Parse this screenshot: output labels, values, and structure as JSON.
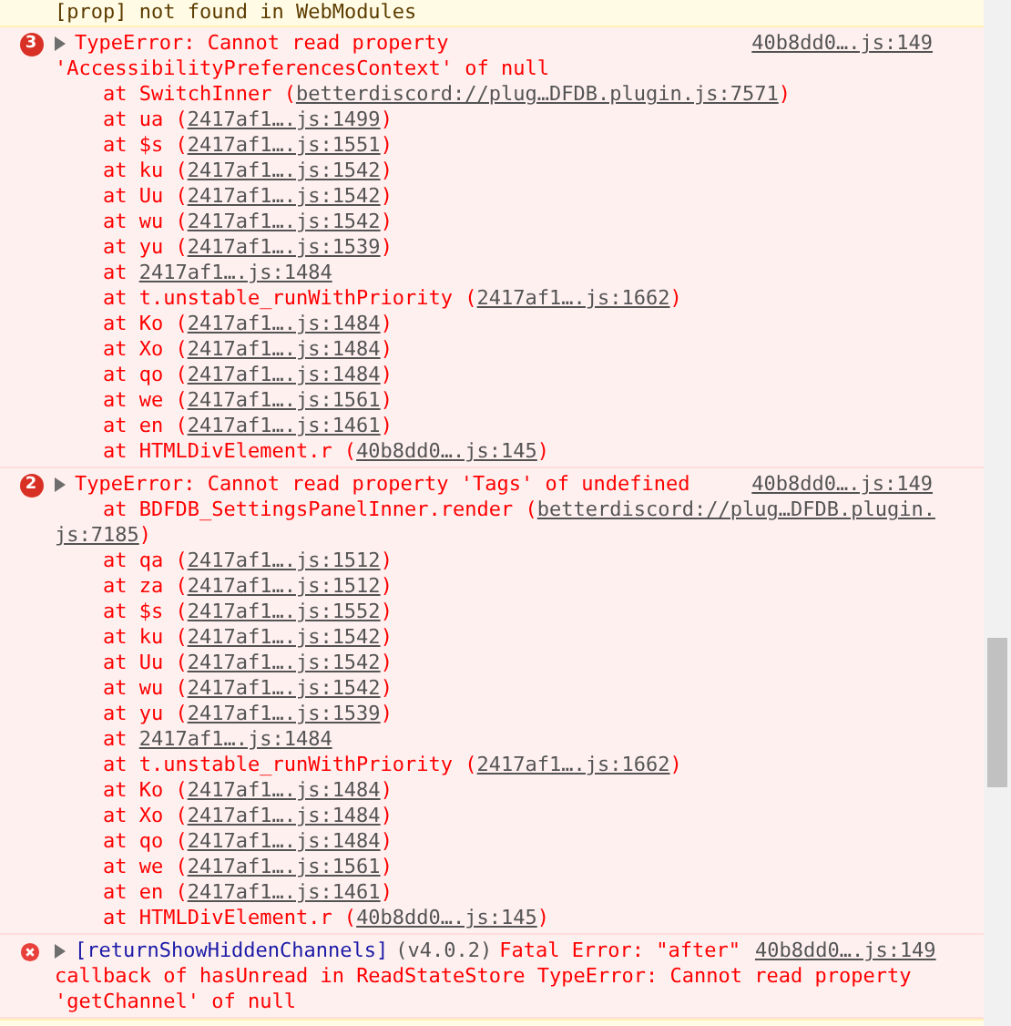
{
  "warning_above": {
    "text": "[prop] not found in WebModules"
  },
  "entries": [
    {
      "kind": "grouped",
      "count": "3",
      "message_lines": [
        "TypeError: Cannot read property",
        "'AccessibilityPreferencesContext' of null"
      ],
      "source": "40b8dd0….js:149",
      "frames": [
        {
          "prefix": "at SwitchInner (",
          "location": "betterdiscord://plug…DFDB.plugin.js:7571",
          "suffix": ")"
        },
        {
          "prefix": "at ua (",
          "location": "2417af1….js:1499",
          "suffix": ")"
        },
        {
          "prefix": "at $s (",
          "location": "2417af1….js:1551",
          "suffix": ")"
        },
        {
          "prefix": "at ku (",
          "location": "2417af1….js:1542",
          "suffix": ")"
        },
        {
          "prefix": "at Uu (",
          "location": "2417af1….js:1542",
          "suffix": ")"
        },
        {
          "prefix": "at wu (",
          "location": "2417af1….js:1542",
          "suffix": ")"
        },
        {
          "prefix": "at yu (",
          "location": "2417af1….js:1539",
          "suffix": ")"
        },
        {
          "prefix": "at",
          "location": "2417af1….js:1484"
        },
        {
          "prefix": "at t.unstable_runWithPriority (",
          "location": "2417af1….js:1662",
          "suffix": ")"
        },
        {
          "prefix": "at Ko (",
          "location": "2417af1….js:1484",
          "suffix": ")"
        },
        {
          "prefix": "at Xo (",
          "location": "2417af1….js:1484",
          "suffix": ")"
        },
        {
          "prefix": "at qo (",
          "location": "2417af1….js:1484",
          "suffix": ")"
        },
        {
          "prefix": "at we (",
          "location": "2417af1….js:1561",
          "suffix": ")"
        },
        {
          "prefix": "at en (",
          "location": "2417af1….js:1461",
          "suffix": ")"
        },
        {
          "prefix": "at HTMLDivElement.r (",
          "location": "40b8dd0….js:145",
          "suffix": ")"
        }
      ]
    },
    {
      "kind": "grouped",
      "count": "2",
      "message_lines": [
        "TypeError: Cannot read property 'Tags' of undefined"
      ],
      "source": "40b8dd0….js:149",
      "frames": [
        {
          "prefix": "at BDFDB_SettingsPanelInner.render (",
          "location": "betterdiscord://plug…DFDB.plugin.",
          "location_continued": "js:7185",
          "suffix": ")"
        },
        {
          "prefix": "at qa (",
          "location": "2417af1….js:1512",
          "suffix": ")"
        },
        {
          "prefix": "at za (",
          "location": "2417af1….js:1512",
          "suffix": ")"
        },
        {
          "prefix": "at $s (",
          "location": "2417af1….js:1552",
          "suffix": ")"
        },
        {
          "prefix": "at ku (",
          "location": "2417af1….js:1542",
          "suffix": ")"
        },
        {
          "prefix": "at Uu (",
          "location": "2417af1….js:1542",
          "suffix": ")"
        },
        {
          "prefix": "at wu (",
          "location": "2417af1….js:1542",
          "suffix": ")"
        },
        {
          "prefix": "at yu (",
          "location": "2417af1….js:1539",
          "suffix": ")"
        },
        {
          "prefix": "at",
          "location": "2417af1….js:1484"
        },
        {
          "prefix": "at t.unstable_runWithPriority (",
          "location": "2417af1….js:1662",
          "suffix": ")"
        },
        {
          "prefix": "at Ko (",
          "location": "2417af1….js:1484",
          "suffix": ")"
        },
        {
          "prefix": "at Xo (",
          "location": "2417af1….js:1484",
          "suffix": ")"
        },
        {
          "prefix": "at qo (",
          "location": "2417af1….js:1484",
          "suffix": ")"
        },
        {
          "prefix": "at we (",
          "location": "2417af1….js:1561",
          "suffix": ")"
        },
        {
          "prefix": "at en (",
          "location": "2417af1….js:1461",
          "suffix": ")"
        },
        {
          "prefix": "at HTMLDivElement.r (",
          "location": "40b8dd0….js:145",
          "suffix": ")"
        }
      ]
    },
    {
      "kind": "single",
      "context": "[returnShowHiddenChannels]",
      "version": "(v4.0.2)",
      "message_lines": [
        "Fatal Error: \"after\"",
        "callback of hasUnread in ReadStateStore TypeError: Cannot read property",
        "'getChannel' of null"
      ],
      "source": "40b8dd0….js:149"
    }
  ]
}
